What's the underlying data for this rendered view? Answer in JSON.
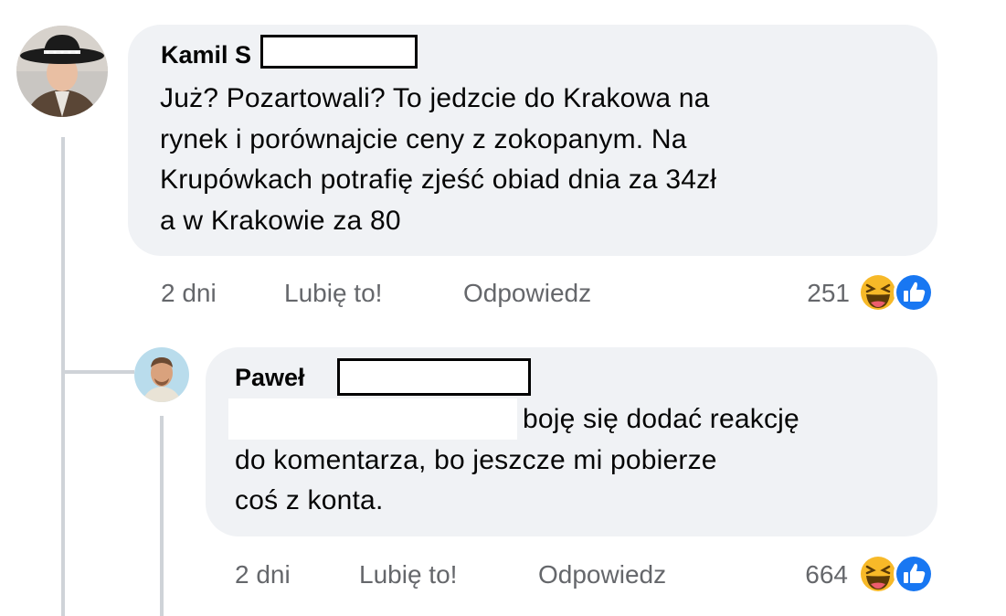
{
  "comments": [
    {
      "author": "Kamil S",
      "lines": [
        "Już? Pozartowali? To jedzcie do Krakowa na",
        "rynek i porównajcie ceny z zokopanym. Na",
        "Krupówkach potrafię zjeść obiad dnia za 34zł",
        "a w Krakowie za 80"
      ],
      "time": "2 dni",
      "like_label": "Lubię to!",
      "reply_label": "Odpowiedz",
      "reaction_count": "251",
      "reaction_icons": [
        "haha-icon",
        "like-icon"
      ]
    },
    {
      "author": "Paweł",
      "lines": [
        "boję się dodać reakcję",
        "do komentarza, bo jeszcze mi pobierze",
        "coś z konta."
      ],
      "time": "2 dni",
      "like_label": "Lubię to!",
      "reply_label": "Odpowiedz",
      "reaction_count": "664",
      "reaction_icons": [
        "haha-icon",
        "like-icon"
      ]
    }
  ],
  "colors": {
    "bubble": "#f0f2f5",
    "meta_text": "#65676b",
    "thread_line": "#cfd3d8",
    "like_blue": "#1877f2",
    "haha_yellow": "#f7b928"
  }
}
